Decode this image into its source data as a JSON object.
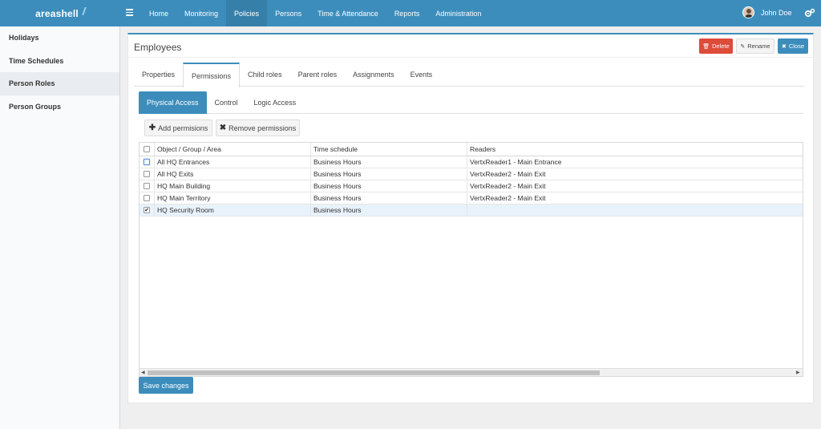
{
  "app": {
    "brand": "areashell"
  },
  "topnav": {
    "items": [
      {
        "label": "Home"
      },
      {
        "label": "Monitoring"
      },
      {
        "label": "Policies"
      },
      {
        "label": "Persons"
      },
      {
        "label": "Time & Attendance"
      },
      {
        "label": "Reports"
      },
      {
        "label": "Administration"
      }
    ],
    "active": "Policies",
    "user_name": "John Doe"
  },
  "sidebar": {
    "items": [
      {
        "label": "Holidays"
      },
      {
        "label": "Time Schedules"
      },
      {
        "label": "Person Roles"
      },
      {
        "label": "Person Groups"
      }
    ],
    "active": "Person Roles"
  },
  "panel": {
    "title": "Employees",
    "buttons": {
      "delete": "Delete",
      "rename": "Rename",
      "close": "Close"
    },
    "tabs": [
      {
        "label": "Properties"
      },
      {
        "label": "Permissions"
      },
      {
        "label": "Child roles"
      },
      {
        "label": "Parent roles"
      },
      {
        "label": "Assignments"
      },
      {
        "label": "Events"
      }
    ],
    "active_tab": "Permissions",
    "subtabs": [
      {
        "label": "Physical Access"
      },
      {
        "label": "Control"
      },
      {
        "label": "Logic Access"
      }
    ],
    "active_subtab": "Physical Access",
    "toolbar": {
      "add": "Add permisions",
      "remove": "Remove permissions"
    },
    "grid": {
      "columns": [
        "Object / Group / Area",
        "Time schedule",
        "Readers"
      ],
      "rows": [
        {
          "object": "All HQ Entrances",
          "schedule": "Business Hours",
          "readers": "VertxReader1 - Main Entrance",
          "checked": false
        },
        {
          "object": "All HQ Exits",
          "schedule": "Business Hours",
          "readers": "VertxReader2 - Main Exit",
          "checked": false
        },
        {
          "object": "HQ Main Building",
          "schedule": "Business Hours",
          "readers": "VertxReader2 - Main Exit",
          "checked": false
        },
        {
          "object": "HQ Main Territory",
          "schedule": "Business Hours",
          "readers": "VertxReader2 - Main Exit",
          "checked": false
        },
        {
          "object": "HQ Security Room",
          "schedule": "Business Hours",
          "readers": "",
          "checked": true
        }
      ]
    },
    "save_label": "Save changes"
  },
  "colors": {
    "primary": "#3c8dbc",
    "danger": "#dd4b39",
    "selected_row": "#e8f2fb"
  },
  "icons": {
    "menu": "hamburger-icon",
    "settings": "gears-icon",
    "delete": "trash-icon",
    "rename": "edit-icon",
    "close": "close-icon",
    "add": "plus-icon",
    "remove": "x-icon"
  }
}
